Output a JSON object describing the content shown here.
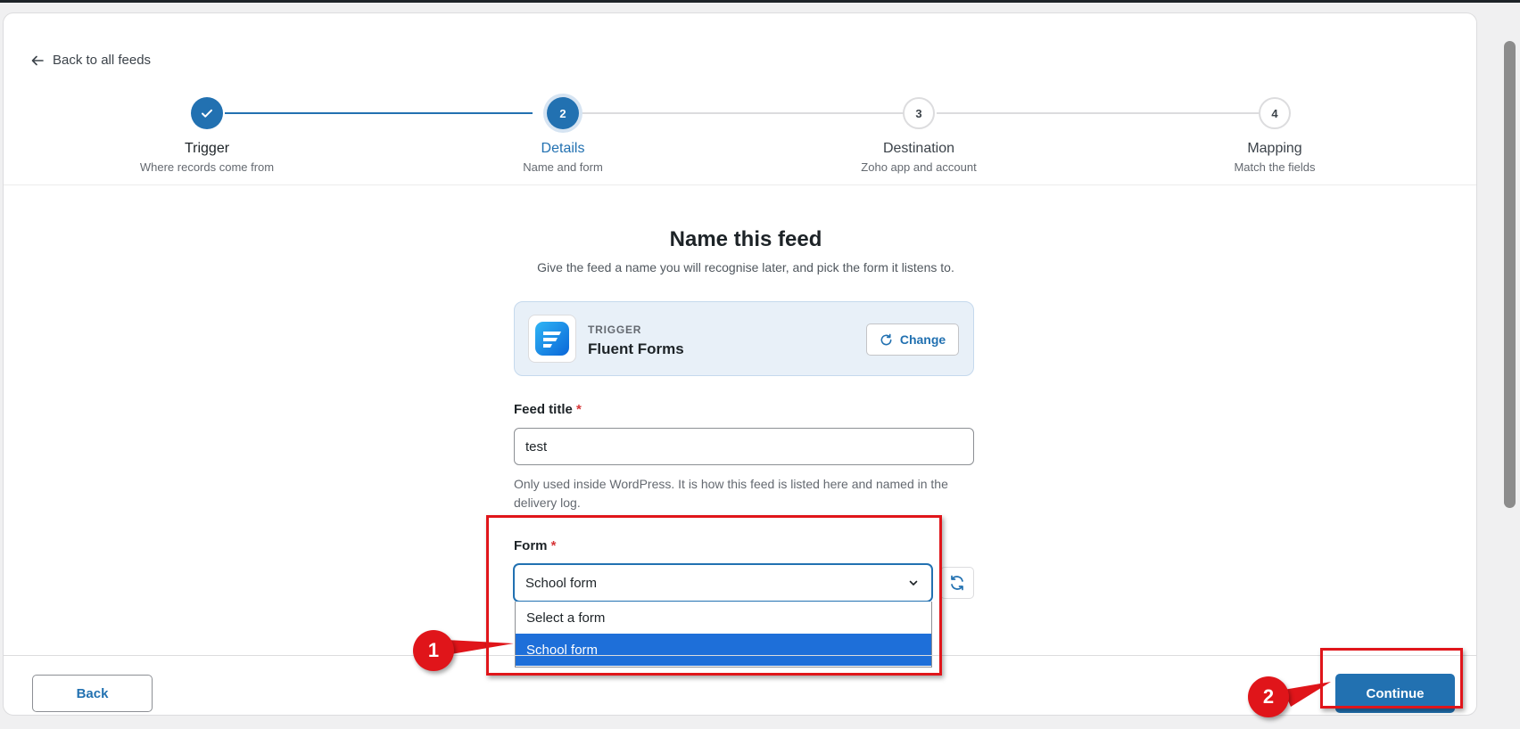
{
  "nav": {
    "back_link_label": "Back to all feeds"
  },
  "stepper": {
    "steps": [
      {
        "number": "1",
        "title": "Trigger",
        "subtitle": "Where records come from",
        "state": "done"
      },
      {
        "number": "2",
        "title": "Details",
        "subtitle": "Name and form",
        "state": "active"
      },
      {
        "number": "3",
        "title": "Destination",
        "subtitle": "Zoho app and account",
        "state": "todo"
      },
      {
        "number": "4",
        "title": "Mapping",
        "subtitle": "Match the fields",
        "state": "todo"
      }
    ]
  },
  "main": {
    "title": "Name this feed",
    "subtitle": "Give the feed a name you will recognise later, and pick the form it listens to."
  },
  "trigger": {
    "label": "TRIGGER",
    "name": "Fluent Forms",
    "change_label": "Change"
  },
  "feed_title": {
    "label": "Feed title",
    "required_mark": "*",
    "value": "test",
    "help": "Only used inside WordPress. It is how this feed is listed here and named in the delivery log."
  },
  "form_select": {
    "label": "Form",
    "required_mark": "*",
    "selected": "School form",
    "options": [
      "Select a form",
      "School form"
    ]
  },
  "footer": {
    "back_label": "Back",
    "continue_label": "Continue"
  },
  "annotations": {
    "badge_1": "1",
    "badge_2": "2",
    "color": "#e0151a"
  },
  "colors": {
    "accent": "#2271b1",
    "selected_option": "#1e6fd9",
    "required": "#d63638"
  }
}
